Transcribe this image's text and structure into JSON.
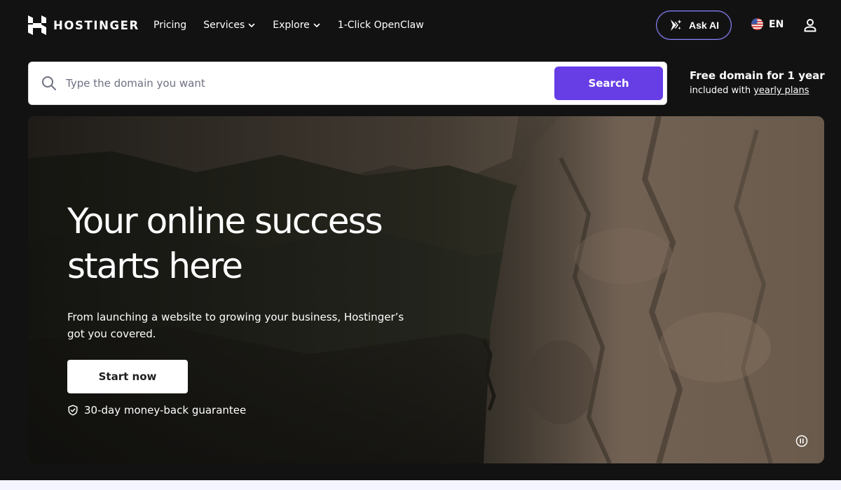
{
  "header": {
    "brand": "HOSTINGER",
    "nav": [
      {
        "label": "Pricing",
        "has_dropdown": false
      },
      {
        "label": "Services",
        "has_dropdown": true
      },
      {
        "label": "Explore",
        "has_dropdown": true
      },
      {
        "label": "1-Click OpenClaw",
        "has_dropdown": false
      }
    ],
    "ask_ai_label": "Ask AI",
    "language": "EN",
    "icons": {
      "logo": "hostinger-logo-icon",
      "ask_ai": "sparkle-arrow-icon",
      "language": "us-flag-icon",
      "account": "user-icon",
      "dropdown": "chevron-down-icon"
    }
  },
  "domain_search": {
    "placeholder": "Type the domain you want",
    "value": "",
    "button_label": "Search",
    "promo_title": "Free domain for 1 year",
    "promo_text": "included with",
    "promo_link": "yearly plans"
  },
  "hero": {
    "title_line1": "Your online success",
    "title_line2": "starts here",
    "subtitle": "From launching a website to growing your business, Hostinger’s got you covered.",
    "cta_label": "Start now",
    "guarantee": "30-day money-back guarantee",
    "background": "rock-climber-cliff-photo"
  },
  "colors": {
    "page_background": "#121212",
    "accent_purple": "#673de6",
    "ask_ai_border": "#8c85ff",
    "text_white": "#ffffff",
    "input_text": "#1d1e20",
    "placeholder": "#6d7081",
    "bottom_strip": "#f4f5ff"
  }
}
